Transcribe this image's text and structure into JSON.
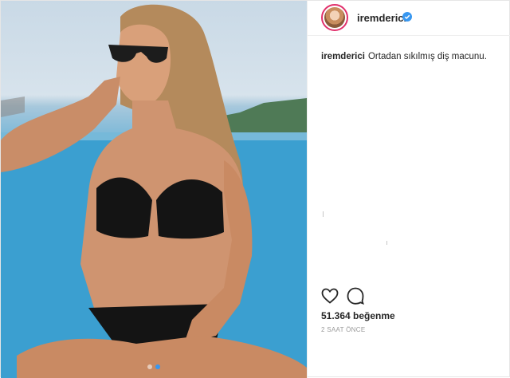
{
  "post": {
    "username": "iremderici",
    "verified": true,
    "caption_user": "iremderici",
    "caption_text": "Ortadan sıkılmış diş macunu.",
    "likes": "51.364 beğenme",
    "time_ago": "2 SAAT ÖNCE",
    "carousel": {
      "count": 2,
      "active_index": 1
    }
  },
  "icons": {
    "like": "heart-outline-icon",
    "comment": "comment-bubble-icon",
    "verified": "verified-badge-icon"
  },
  "colors": {
    "accent_blue": "#3897f0",
    "avatar_ring": "#e1306c",
    "text": "#262626",
    "muted": "#999999"
  }
}
